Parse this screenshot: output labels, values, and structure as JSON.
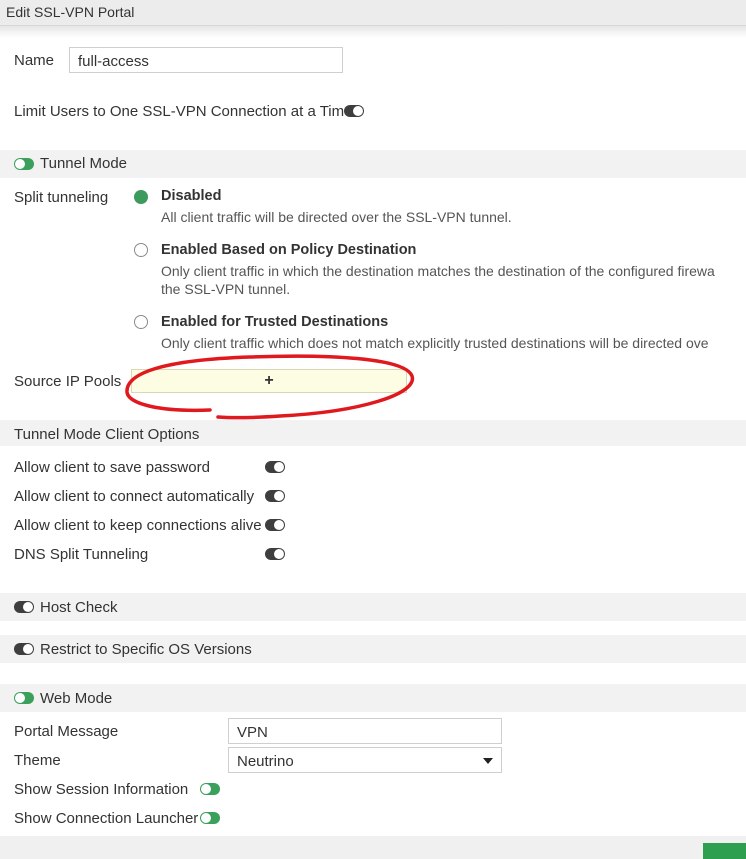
{
  "window": {
    "title": "Edit SSL-VPN Portal"
  },
  "name": {
    "label": "Name",
    "value": "full-access"
  },
  "limit_users": {
    "label": "Limit Users to One SSL-VPN Connection at a Time",
    "enabled": false
  },
  "tunnel_mode": {
    "label": "Tunnel Mode",
    "enabled": true,
    "split_tunneling": {
      "label": "Split tunneling",
      "options": [
        {
          "title": "Disabled",
          "description": [
            "All client traffic will be directed over the SSL-VPN tunnel."
          ],
          "selected": true
        },
        {
          "title": "Enabled Based on Policy Destination",
          "description": [
            "Only client traffic in which the destination matches the destination of the configured firewa",
            "the SSL-VPN tunnel."
          ],
          "selected": false
        },
        {
          "title": "Enabled for Trusted Destinations",
          "description": [
            "Only client traffic which does not match explicitly trusted destinations will be directed ove"
          ],
          "selected": false
        }
      ]
    },
    "source_ip_pools": {
      "label": "Source IP Pools",
      "add_symbol": "+"
    }
  },
  "client_options": {
    "header": "Tunnel Mode Client Options",
    "items": [
      {
        "label": "Allow client to save password",
        "enabled": false
      },
      {
        "label": "Allow client to connect automatically",
        "enabled": false
      },
      {
        "label": "Allow client to keep connections alive",
        "enabled": false
      },
      {
        "label": "DNS Split Tunneling",
        "enabled": false
      }
    ]
  },
  "host_check": {
    "label": "Host Check",
    "enabled": false
  },
  "restrict_os": {
    "label": "Restrict to Specific OS Versions",
    "enabled": false
  },
  "web_mode": {
    "label": "Web Mode",
    "enabled": true,
    "portal_message": {
      "label": "Portal Message",
      "value": "VPN"
    },
    "theme": {
      "label": "Theme",
      "value": "Neutrino"
    },
    "show_session_info": {
      "label": "Show Session Information",
      "enabled": true
    },
    "show_connection_launcher": {
      "label": "Show Connection Launcher",
      "enabled": true
    }
  },
  "colors": {
    "accent_green": "#3aa05b",
    "annotation_red": "#e0191f"
  },
  "icons": {
    "toggle": "toggle-switch-icon",
    "caret": "chevron-down-icon",
    "add": "plus-icon"
  }
}
